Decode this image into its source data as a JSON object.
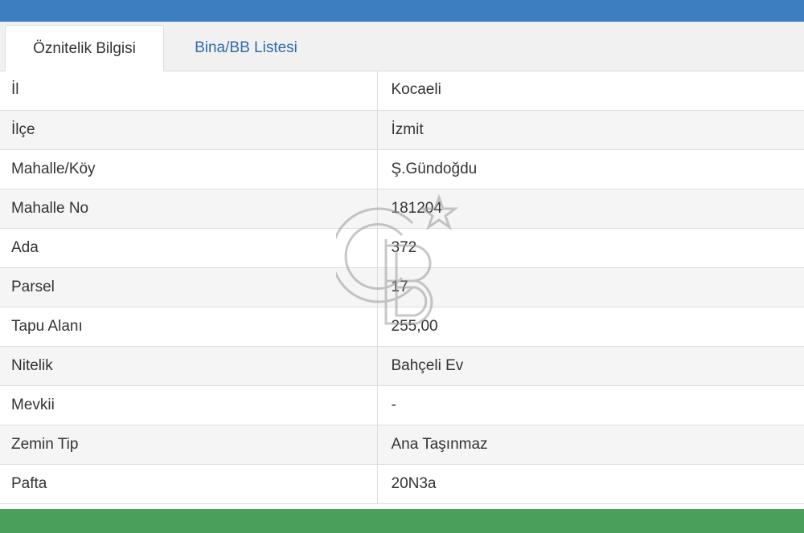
{
  "tabs": [
    {
      "label": "Öznitelik Bilgisi",
      "active": true
    },
    {
      "label": "Bina/BB Listesi",
      "active": false
    }
  ],
  "rows": [
    {
      "label": "İl",
      "value": "Kocaeli"
    },
    {
      "label": "İlçe",
      "value": "İzmit"
    },
    {
      "label": "Mahalle/Köy",
      "value": "Ş.Gündoğdu"
    },
    {
      "label": "Mahalle No",
      "value": "181204"
    },
    {
      "label": "Ada",
      "value": "372"
    },
    {
      "label": "Parsel",
      "value": "17"
    },
    {
      "label": "Tapu Alanı",
      "value": "255,00"
    },
    {
      "label": "Nitelik",
      "value": "Bahçeli Ev"
    },
    {
      "label": "Mevkii",
      "value": "-"
    },
    {
      "label": "Zemin Tip",
      "value": "Ana Taşınmaz"
    },
    {
      "label": "Pafta",
      "value": "20N3a"
    }
  ],
  "colors": {
    "header_bar": "#3d7ec0",
    "active_tab_text": "#333333",
    "inactive_tab_text": "#2e6da4",
    "bottom_bar": "#4aa05a"
  },
  "watermark_icon": "cb-logo-watermark"
}
